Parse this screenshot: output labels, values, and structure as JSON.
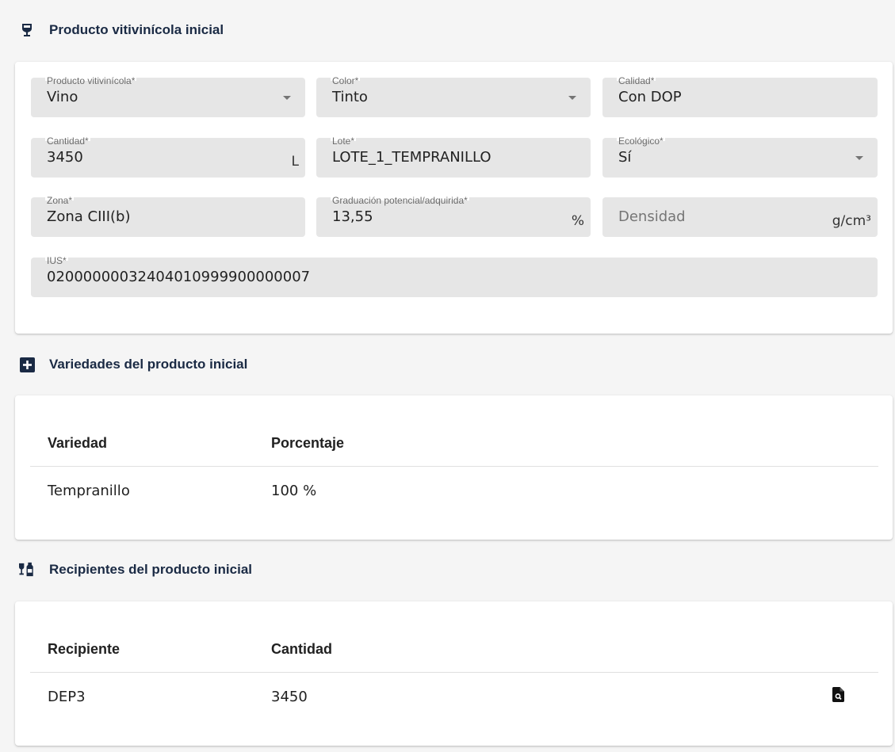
{
  "sections": {
    "producto": {
      "title": "Producto vitivinícola inicial",
      "icon": "wine-glass-icon"
    },
    "variedades": {
      "title": "Variedades del producto inicial",
      "icon": "plus-square-icon"
    },
    "recipientes": {
      "title": "Recipientes del producto inicial",
      "icon": "bottles-icon"
    }
  },
  "form": {
    "producto": {
      "label": "Producto vitivinícola*",
      "value": "Vino"
    },
    "color": {
      "label": "Color*",
      "value": "Tinto"
    },
    "calidad": {
      "label": "Calidad*",
      "value": "Con DOP"
    },
    "cantidad": {
      "label": "Cantidad*",
      "value": "3450",
      "suffix": "L"
    },
    "lote": {
      "label": "Lote*",
      "value": "LOTE_1_TEMPRANILLO"
    },
    "ecologico": {
      "label": "Ecológico*",
      "value": "Sí"
    },
    "zona": {
      "label": "Zona*",
      "value": "Zona CIII(b)"
    },
    "graduacion": {
      "label": "Graduación potencial/adquirida*",
      "value": "13,55",
      "suffix": "%"
    },
    "densidad": {
      "placeholder": "Densidad",
      "suffix": "g/cm³"
    },
    "ius": {
      "label": "IUS*",
      "value": "02000000032404010999900000007"
    }
  },
  "variedades_table": {
    "headers": [
      "Variedad",
      "Porcentaje"
    ],
    "rows": [
      [
        "Tempranillo",
        "100 %"
      ]
    ]
  },
  "recipientes_table": {
    "headers": [
      "Recipiente",
      "Cantidad"
    ],
    "rows": [
      [
        "DEP3",
        "3450"
      ]
    ],
    "row_action_icon": "file-search-icon"
  },
  "colors": {
    "header_text": "#1a2a44",
    "field_bg": "#e6e6e6",
    "page_bg": "#f5f5f5"
  }
}
